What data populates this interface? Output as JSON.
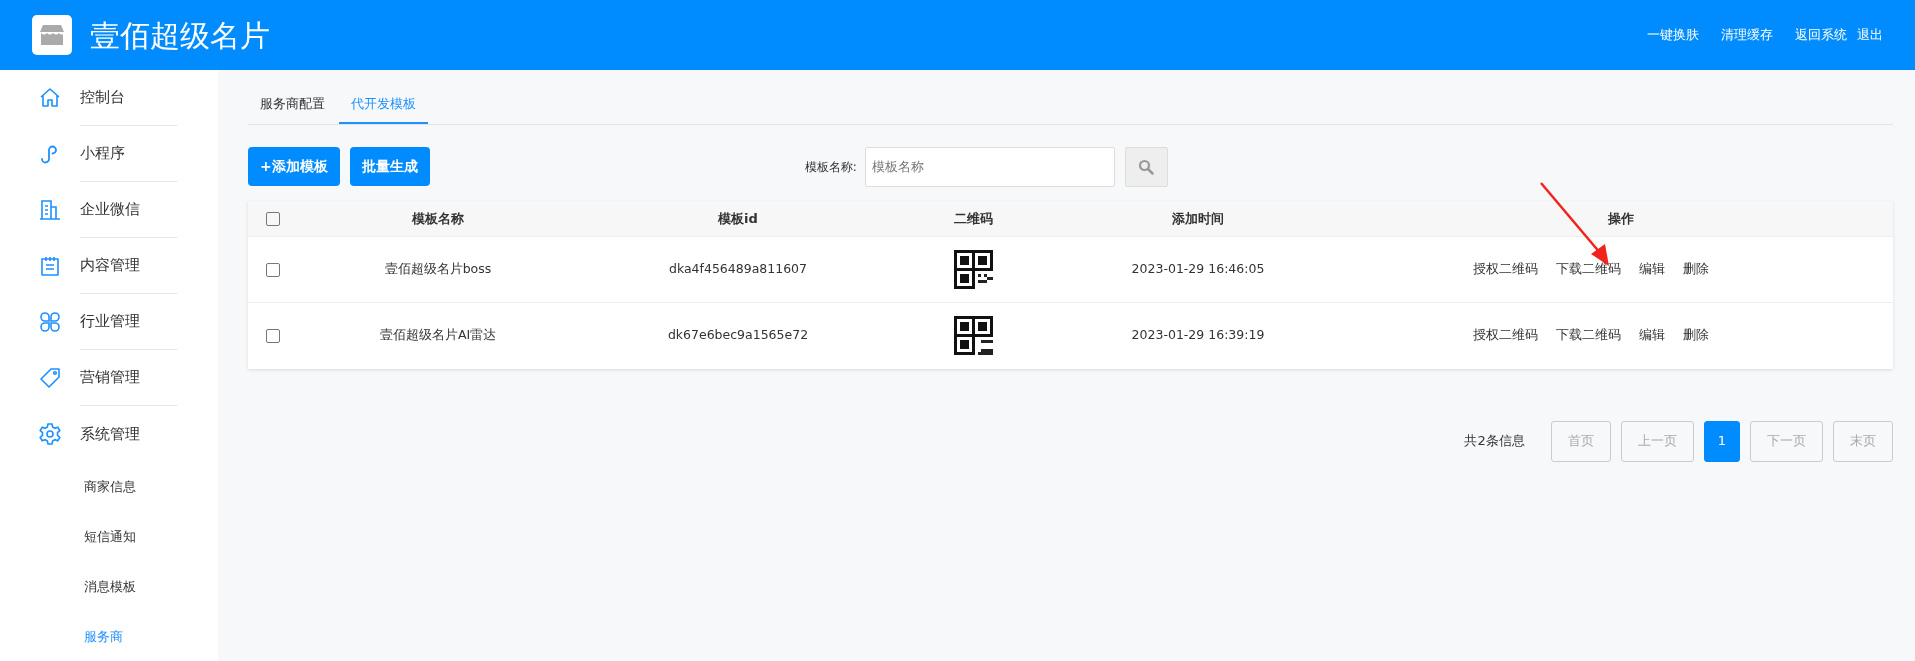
{
  "header": {
    "title": "壹佰超级名片",
    "links": [
      "一键换肤",
      "清理缓存",
      "返回系统",
      "退出"
    ]
  },
  "sidebar": {
    "items": [
      {
        "label": "控制台",
        "selected": false
      },
      {
        "label": "小程序",
        "selected": false
      },
      {
        "label": "企业微信",
        "selected": false
      },
      {
        "label": "内容管理",
        "selected": false
      },
      {
        "label": "行业管理",
        "selected": false
      },
      {
        "label": "营销管理",
        "selected": false
      },
      {
        "label": "系统管理",
        "selected": false,
        "expanded": true,
        "children": [
          {
            "label": "商家信息",
            "selected": false
          },
          {
            "label": "短信通知",
            "selected": false
          },
          {
            "label": "消息模板",
            "selected": false
          },
          {
            "label": "服务商",
            "selected": true
          }
        ]
      }
    ]
  },
  "tabs": [
    {
      "label": "服务商配置",
      "selected": false
    },
    {
      "label": "代开发模板",
      "selected": true
    }
  ],
  "toolbar": {
    "buttons": [
      "+添加模板",
      "批量生成"
    ],
    "search_label": "模板名称:",
    "search": {
      "placeholder": "模板名称"
    }
  },
  "table": {
    "columns": [
      "模板名称",
      "模板id",
      "二维码",
      "添加时间",
      "操作"
    ],
    "select_all_checked": false,
    "rows": [
      {
        "checked": false,
        "name": "壹佰超级名片boss",
        "id": "dka4f456489a811607",
        "added": "2023-01-29 16:46:05",
        "actions": [
          "授权二维码",
          "下载二维码",
          "编辑",
          "删除"
        ]
      },
      {
        "checked": false,
        "name": "壹佰超级名片AI雷达",
        "id": "dk67e6bec9a1565e72",
        "added": "2023-01-29 16:39:19",
        "actions": [
          "授权二维码",
          "下载二维码",
          "编辑",
          "删除"
        ]
      }
    ]
  },
  "pagination": {
    "summary": "共2条信息",
    "pages": [
      {
        "label": "首页",
        "selected": false
      },
      {
        "label": "上一页",
        "selected": false
      },
      {
        "label": "1",
        "selected": true
      },
      {
        "label": "下一页",
        "selected": false
      },
      {
        "label": "末页",
        "selected": false
      }
    ]
  }
}
